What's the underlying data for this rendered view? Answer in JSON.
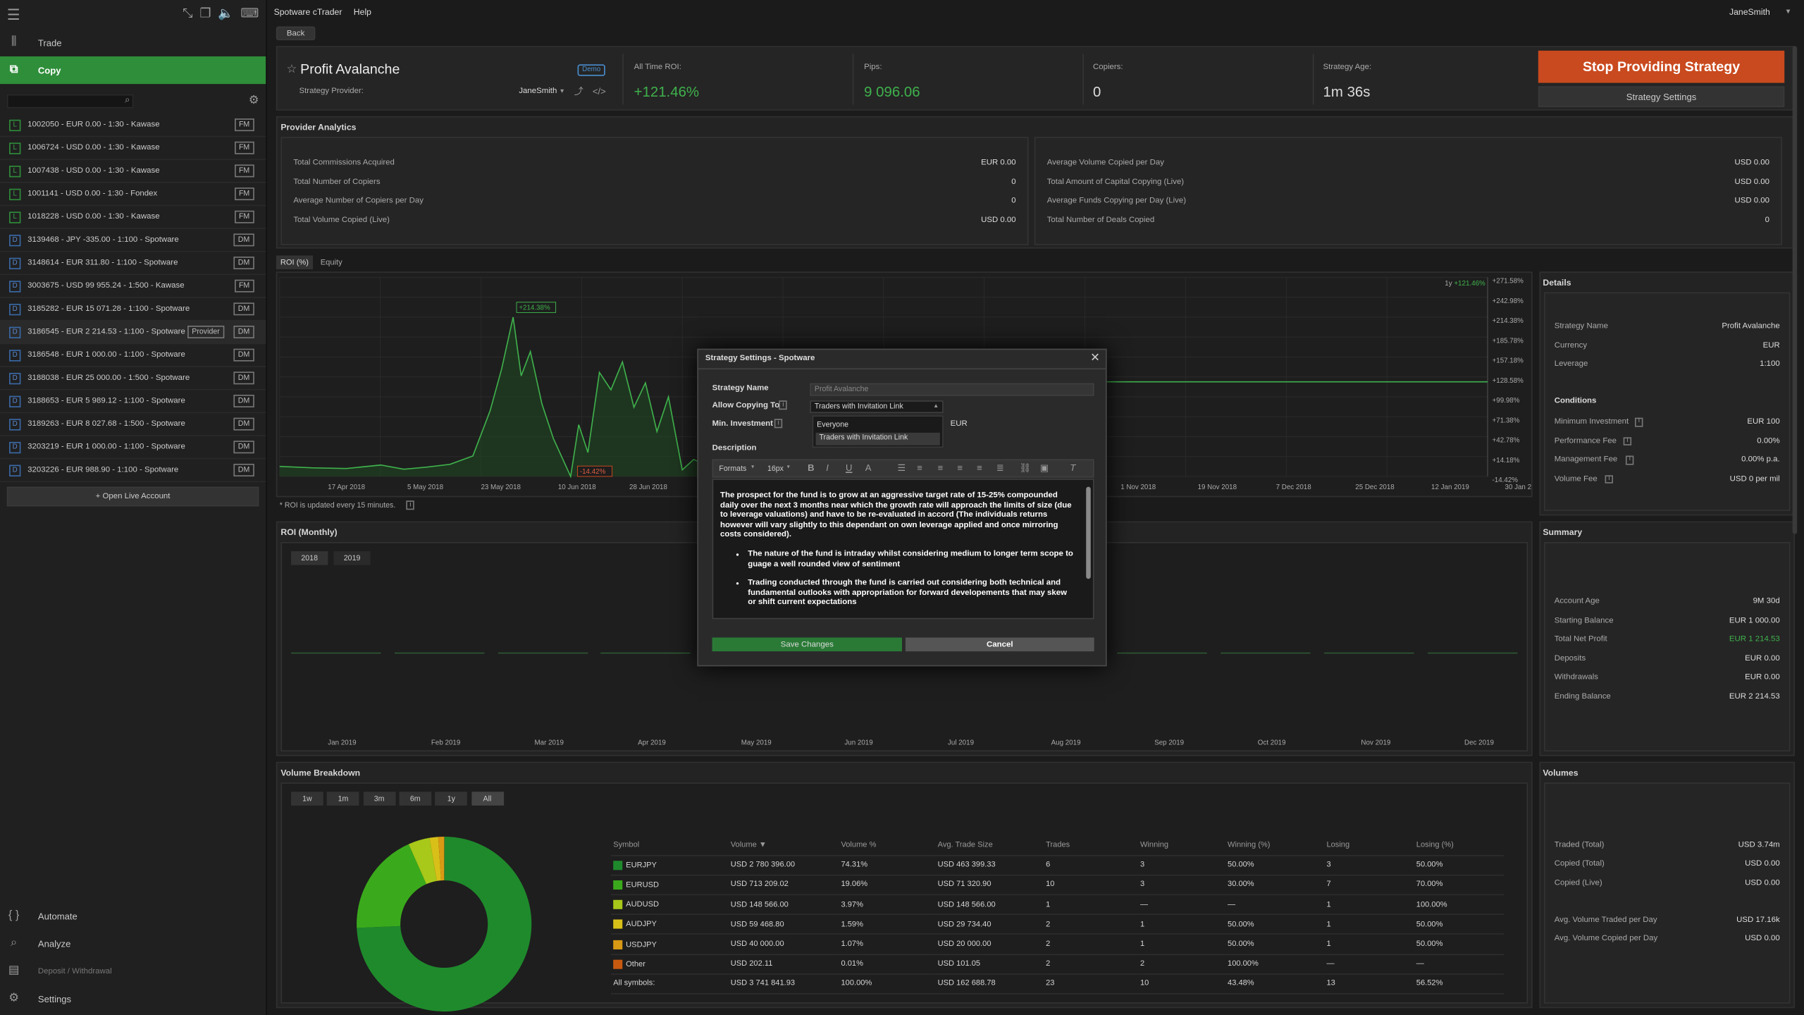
{
  "sidebar": {
    "nav_top": [
      {
        "label": "Trade",
        "icon": "trade-icon"
      },
      {
        "label": "Copy",
        "icon": "copy-icon"
      }
    ],
    "search_placeholder": "",
    "accounts": [
      {
        "type": "L",
        "label": "1002050 - EUR 0.00 - 1:30 - Kawase",
        "badge": "FM"
      },
      {
        "type": "L",
        "label": "1006724 - USD 0.00 - 1:30 - Kawase",
        "badge": "FM"
      },
      {
        "type": "L",
        "label": "1007438 - USD 0.00 - 1:30 - Kawase",
        "badge": "FM"
      },
      {
        "type": "L",
        "label": "1001141 - USD 0.00 - 1:30 - Fondex",
        "badge": "FM"
      },
      {
        "type": "L",
        "label": "1018228 - USD 0.00 - 1:30 - Kawase",
        "badge": "FM"
      },
      {
        "type": "D",
        "label": "3139468 - JPY -335.00 - 1:100 - Spotware",
        "badge": "DM"
      },
      {
        "type": "D",
        "label": "3148614 - EUR 311.80 - 1:100 - Spotware",
        "badge": "DM"
      },
      {
        "type": "D",
        "label": "3003675 - USD 99 955.24 - 1:500 - Kawase",
        "badge": "FM"
      },
      {
        "type": "D",
        "label": "3185282 - EUR 15 071.28 - 1:100 - Spotware",
        "badge": "DM"
      },
      {
        "type": "D",
        "label": "3186545 - EUR 2 214.53 - 1:100 - Spotware",
        "badge": "DM",
        "provider": "Provider"
      },
      {
        "type": "D",
        "label": "3186548 - EUR 1 000.00 - 1:100 - Spotware",
        "badge": "DM"
      },
      {
        "type": "D",
        "label": "3188038 - EUR 25 000.00 - 1:500 - Spotware",
        "badge": "DM"
      },
      {
        "type": "D",
        "label": "3188653 - EUR 5 989.12 - 1:100 - Spotware",
        "badge": "DM"
      },
      {
        "type": "D",
        "label": "3189263 - EUR 8 027.68 - 1:500 - Spotware",
        "badge": "DM"
      },
      {
        "type": "D",
        "label": "3203219 - EUR 1 000.00 - 1:100 - Spotware",
        "badge": "DM"
      },
      {
        "type": "D",
        "label": "3203226 - EUR 988.90 - 1:100 - Spotware",
        "badge": "DM"
      }
    ],
    "open_live": "+ Open Live Account",
    "nav_bottom": [
      {
        "label": "Automate",
        "icon": "code-icon"
      },
      {
        "label": "Analyze",
        "icon": "magnifier-icon"
      },
      {
        "label": "Deposit / Withdrawal",
        "icon": "wallet-icon"
      },
      {
        "label": "Settings",
        "icon": "gear-icon"
      }
    ]
  },
  "menubar": {
    "app": "Spotware cTrader",
    "help": "Help",
    "user": "JaneSmith"
  },
  "back": "Back",
  "header": {
    "title": "Profit Avalanche",
    "demo": "Demo",
    "provider_label": "Strategy Provider:",
    "provider_name": "JaneSmith",
    "roi_label": "All Time ROI:",
    "roi": "+121.46%",
    "pips_label": "Pips:",
    "pips": "9 096.06",
    "copiers_label": "Copiers:",
    "copiers": "0",
    "age_label": "Strategy Age:",
    "age": "1m 36s",
    "stop_btn": "Stop Providing Strategy",
    "settings_btn": "Strategy Settings"
  },
  "analytics": {
    "title": "Provider Analytics",
    "left": [
      [
        "Total Commissions Acquired",
        "EUR 0.00"
      ],
      [
        "Total Number of Copiers",
        "0"
      ],
      [
        "Average Number of Copiers per Day",
        "0"
      ],
      [
        "Total Volume Copied (Live)",
        "USD 0.00"
      ]
    ],
    "right": [
      [
        "Average Volume Copied per Day",
        "USD 0.00"
      ],
      [
        "Total Amount of Capital Copying (Live)",
        "USD 0.00"
      ],
      [
        "Average Funds Copying per Day (Live)",
        "USD 0.00"
      ],
      [
        "Total Number of Deals Copied",
        "0"
      ]
    ]
  },
  "tabs": [
    "ROI (%)",
    "Equity"
  ],
  "ranges": [
    "1w",
    "1m",
    "3m",
    "6m",
    "1y",
    "All"
  ],
  "roi_chart": {
    "period_label": "1y",
    "period_value": "+121.46%",
    "peak": "+214.38%",
    "low": "-14.42%",
    "yticks": [
      "+271.58%",
      "+242.98%",
      "+214.38%",
      "+185.78%",
      "+157.18%",
      "+128.58%",
      "+99.98%",
      "+71.38%",
      "+42.78%",
      "+14.18%",
      "-14.42%"
    ],
    "xticks": [
      "17 Apr 2018",
      "5 May 2018",
      "23 May 2018",
      "10 Jun 2018",
      "28 Jun 2018",
      "1 Nov 2018",
      "19 Nov 2018",
      "7 Dec 2018",
      "25 Dec 2018",
      "12 Jan 2019",
      "30 Jan 2019"
    ],
    "note": "* ROI is updated every 15 minutes."
  },
  "details": {
    "title": "Details",
    "rows": [
      [
        "Strategy Name",
        "Profit Avalanche"
      ],
      [
        "Currency",
        "EUR"
      ],
      [
        "Leverage",
        "1:100"
      ]
    ],
    "cond_title": "Conditions",
    "cond": [
      [
        "Minimum Investment",
        "EUR 100"
      ],
      [
        "Performance Fee",
        "0.00%"
      ],
      [
        "Management Fee",
        "0.00% p.a."
      ],
      [
        "Volume Fee",
        "USD 0 per mil"
      ]
    ]
  },
  "monthly": {
    "title": "ROI (Monthly)",
    "years": [
      "2018",
      "2019"
    ],
    "months": [
      "Jan 2019",
      "Feb 2019",
      "Mar 2019",
      "Apr 2019",
      "May 2019",
      "Jun 2019",
      "Jul 2019",
      "Aug 2019",
      "Sep 2019",
      "Oct 2019",
      "Nov 2019",
      "Dec 2019"
    ]
  },
  "summary": {
    "title": "Summary",
    "rows": [
      [
        "Account Age",
        "9M 30d"
      ],
      [
        "Starting Balance",
        "EUR 1 000.00"
      ],
      [
        "Total Net Profit",
        "EUR 1 214.53"
      ],
      [
        "Deposits",
        "EUR 0.00"
      ],
      [
        "Withdrawals",
        "EUR 0.00"
      ],
      [
        "Ending Balance",
        "EUR 2 214.53"
      ]
    ]
  },
  "volume": {
    "title": "Volume Breakdown",
    "headers": [
      "Symbol",
      "Volume ▼",
      "Volume %",
      "Avg. Trade Size",
      "Trades",
      "Winning",
      "Winning (%)",
      "Losing",
      "Losing (%)"
    ],
    "rows": [
      {
        "symbol": "EURJPY",
        "color": "#1f8a2c",
        "cells": [
          "USD 2 780 396.00",
          "74.31%",
          "USD 463 399.33",
          "6",
          "3",
          "50.00%",
          "3",
          "50.00%"
        ]
      },
      {
        "symbol": "EURUSD",
        "color": "#3aaa1c",
        "cells": [
          "USD 713 209.02",
          "19.06%",
          "USD 71 320.90",
          "10",
          "3",
          "30.00%",
          "7",
          "70.00%"
        ]
      },
      {
        "symbol": "AUDUSD",
        "color": "#a8c81a",
        "cells": [
          "USD 148 566.00",
          "3.97%",
          "USD 148 566.00",
          "1",
          "—",
          "—",
          "1",
          "100.00%"
        ]
      },
      {
        "symbol": "AUDJPY",
        "color": "#d8c018",
        "cells": [
          "USD 59 468.80",
          "1.59%",
          "USD 29 734.40",
          "2",
          "1",
          "50.00%",
          "1",
          "50.00%"
        ]
      },
      {
        "symbol": "USDJPY",
        "color": "#d89a14",
        "cells": [
          "USD 40 000.00",
          "1.07%",
          "USD 20 000.00",
          "2",
          "1",
          "50.00%",
          "1",
          "50.00%"
        ]
      },
      {
        "symbol": "Other",
        "color": "#c85a10",
        "cells": [
          "USD 202.11",
          "0.01%",
          "USD 101.05",
          "2",
          "2",
          "100.00%",
          "—",
          "—"
        ]
      }
    ],
    "total": [
      "All symbols:",
      "USD 3 741 841.93",
      "100.00%",
      "USD 162 688.78",
      "23",
      "10",
      "43.48%",
      "13",
      "56.52%"
    ],
    "pie": [
      74.31,
      19.06,
      3.97,
      1.59,
      1.07,
      0.01
    ]
  },
  "volumes": {
    "title": "Volumes",
    "rows": [
      [
        "Traded (Total)",
        "USD 3.74m"
      ],
      [
        "Copied (Total)",
        "USD 0.00"
      ],
      [
        "Copied (Live)",
        "USD 0.00"
      ]
    ],
    "rows2": [
      [
        "Avg. Volume Traded per Day",
        "USD 17.16k"
      ],
      [
        "Avg. Volume Copied per Day",
        "USD 0.00"
      ]
    ]
  },
  "modal": {
    "title": "Strategy Settings - Spotware",
    "name_label": "Strategy Name",
    "name_value": "Profit Avalanche",
    "allow_label": "Allow Copying To",
    "allow_value": "Traders with Invitation Link",
    "options": [
      "Everyone",
      "Traders with Invitation Link"
    ],
    "min_label": "Min. Investment",
    "currency": "EUR",
    "desc_label": "Description",
    "formats": "Formats",
    "size": "16px",
    "para": "The prospect for the fund is to grow at an aggressive target rate of 15-25% compounded daily over the next 3 months near which the growth rate will approach the limits of size (due to leverage valuations) and have to be re-evaluated in accord (The individuals returns however will vary slightly to this dependant on own leverage applied and once mirroring costs considered).",
    "bullets": [
      "The nature of the fund is intraday whilst considering medium to longer term scope to guage a well rounded view of sentiment",
      "Trading conducted through the fund is carried out considering both technical and fundamental outlooks with appropriation for forward developements that may skew or shift current expectations"
    ],
    "save": "Save Changes",
    "cancel": "Cancel"
  },
  "colors": {
    "accent": "#2f8e3a",
    "stop": "#c94a1e",
    "green": "#3fb14c"
  }
}
